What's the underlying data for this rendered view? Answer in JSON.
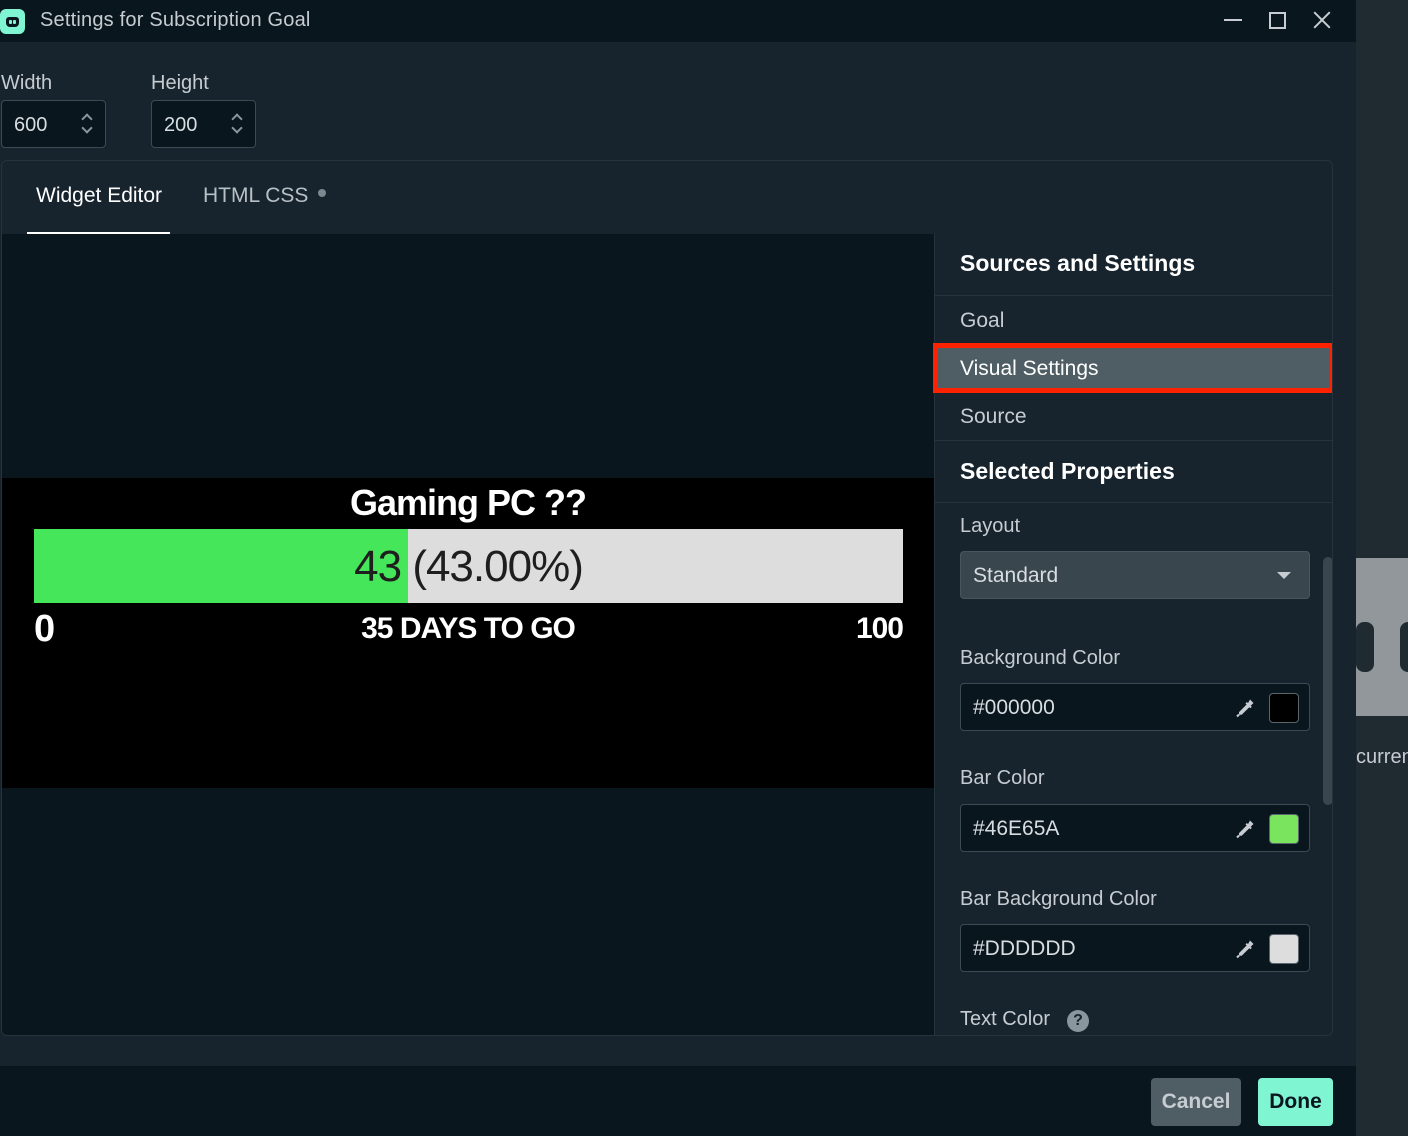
{
  "window": {
    "title": "Settings for Subscription Goal",
    "controls": [
      "minimize-icon",
      "maximize-icon",
      "close-icon"
    ]
  },
  "dimensions": {
    "width_label": "Width",
    "width_value": "600",
    "height_label": "Height",
    "height_value": "200"
  },
  "tabs": [
    {
      "label": "Widget Editor",
      "active": true
    },
    {
      "label": "HTML CSS",
      "active": false
    }
  ],
  "widget": {
    "title": "Gaming PC ??",
    "current": "43",
    "percent_text": "(43.00%)",
    "progress_fraction": 0.43,
    "min": "0",
    "max": "100",
    "days_text": "35 DAYS TO GO"
  },
  "sidebar": {
    "sources_heading": "Sources and Settings",
    "items": [
      {
        "label": "Goal",
        "selected": false
      },
      {
        "label": "Visual Settings",
        "selected": true
      },
      {
        "label": "Source",
        "selected": false
      }
    ],
    "properties_heading": "Selected Properties"
  },
  "properties": {
    "layout_label": "Layout",
    "layout_value": "Standard",
    "background_color_label": "Background Color",
    "background_color_value": "#000000",
    "bar_color_label": "Bar Color",
    "bar_color_value": "#46E65A",
    "bar_bg_color_label": "Bar Background Color",
    "bar_bg_color_value": "#DDDDDD",
    "text_color_label": "Text Color"
  },
  "background_window": {
    "text": "curren"
  },
  "footer": {
    "cancel_label": "Cancel",
    "done_label": "Done"
  },
  "colors": {
    "accent": "#80f5d2",
    "highlight_outline": "#ff2200",
    "bar_fill": "#46E65A",
    "bar_background": "#DDDDDD",
    "widget_background": "#000000"
  }
}
